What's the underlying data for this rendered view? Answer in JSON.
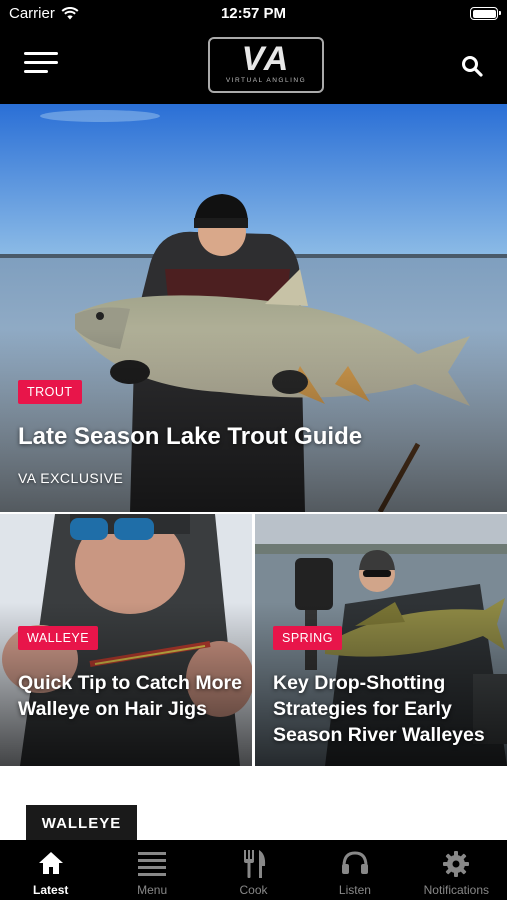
{
  "status_bar": {
    "carrier": "Carrier",
    "time": "12:57 PM"
  },
  "header": {
    "logo_main": "VA",
    "logo_sub": "VIRTUAL ANGLING"
  },
  "hero": {
    "tag": "TROUT",
    "title": "Late Season Lake Trout Guide",
    "meta": "VA EXCLUSIVE"
  },
  "cards": [
    {
      "tag": "WALLEYE",
      "title": "Quick Tip to Catch More Walleye on Hair Jigs"
    },
    {
      "tag": "SPRING",
      "title": "Key Drop-Shotting Strategies for Early Season River Walleyes"
    }
  ],
  "section": {
    "label": "WALLEYE"
  },
  "tabs": [
    {
      "label": "Latest",
      "icon": "home-icon",
      "active": true
    },
    {
      "label": "Menu",
      "icon": "menu-icon",
      "active": false
    },
    {
      "label": "Cook",
      "icon": "fork-knife-icon",
      "active": false
    },
    {
      "label": "Listen",
      "icon": "headphones-icon",
      "active": false
    },
    {
      "label": "Notifications",
      "icon": "gear-icon",
      "active": false
    }
  ],
  "colors": {
    "accent": "#e8154a",
    "bar": "#000000",
    "inactive_tab": "#888888"
  }
}
